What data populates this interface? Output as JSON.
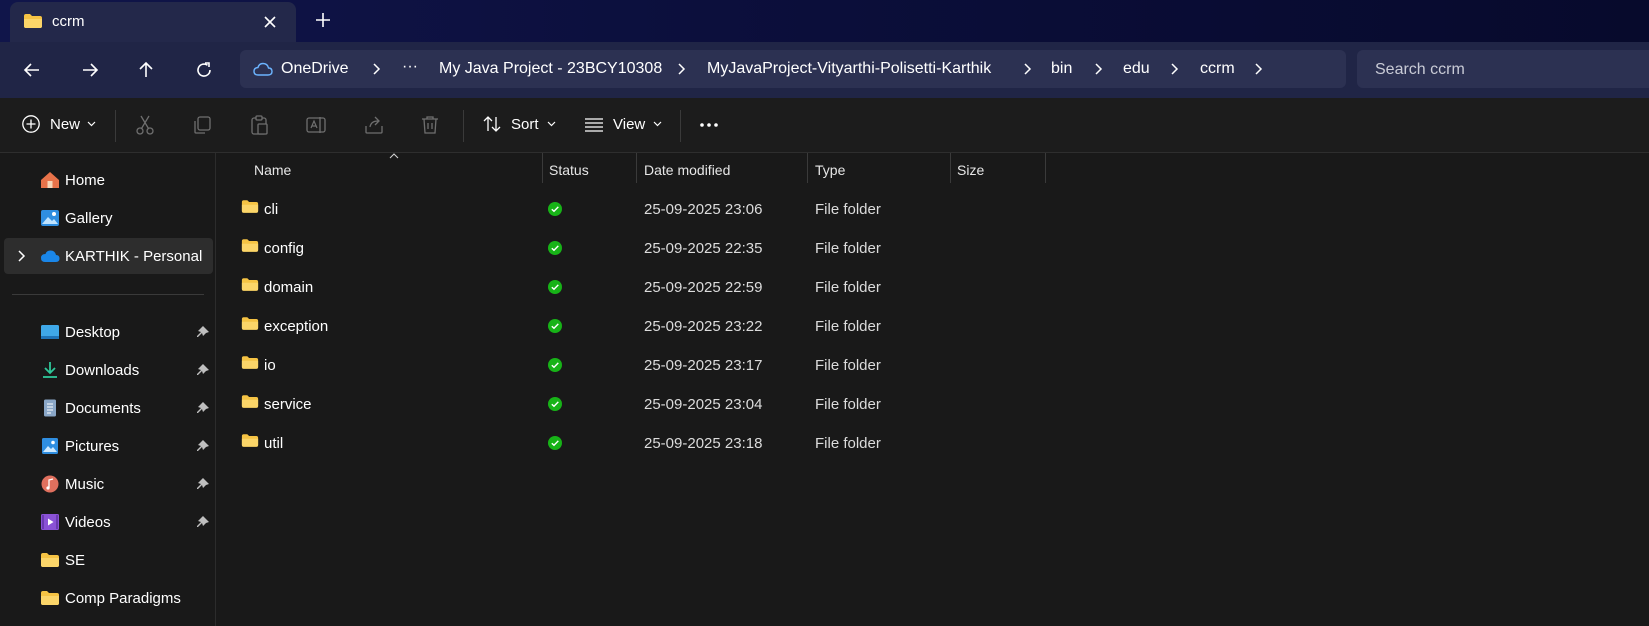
{
  "tab": {
    "title": "ccrm"
  },
  "address": {
    "root": "OneDrive",
    "overflow": "···",
    "crumbs": [
      "My Java Project - 23BCY10308",
      "MyJavaProject-Vityarthi-Polisetti-Karthik",
      "bin",
      "edu",
      "ccrm"
    ]
  },
  "search": {
    "placeholder": "Search ccrm"
  },
  "toolbar": {
    "new_label": "New",
    "sort_label": "Sort",
    "view_label": "View"
  },
  "sidebar": {
    "top": [
      {
        "label": "Home",
        "icon": "home-icon"
      },
      {
        "label": "Gallery",
        "icon": "gallery-icon"
      },
      {
        "label": "KARTHIK - Personal",
        "icon": "onedrive-icon"
      }
    ],
    "quick": [
      {
        "label": "Desktop",
        "icon": "desktop-icon",
        "pinned": true
      },
      {
        "label": "Downloads",
        "icon": "downloads-icon",
        "pinned": true
      },
      {
        "label": "Documents",
        "icon": "documents-icon",
        "pinned": true
      },
      {
        "label": "Pictures",
        "icon": "pictures-icon",
        "pinned": true
      },
      {
        "label": "Music",
        "icon": "music-icon",
        "pinned": true
      },
      {
        "label": "Videos",
        "icon": "videos-icon",
        "pinned": true
      },
      {
        "label": "SE",
        "icon": "folder-icon",
        "pinned": false
      },
      {
        "label": "Comp Paradigms",
        "icon": "folder-icon",
        "pinned": false
      }
    ]
  },
  "columns": {
    "name": "Name",
    "status": "Status",
    "date": "Date modified",
    "type": "Type",
    "size": "Size"
  },
  "files": [
    {
      "name": "cli",
      "date": "25-09-2025 23:06",
      "type": "File folder"
    },
    {
      "name": "config",
      "date": "25-09-2025 22:35",
      "type": "File folder"
    },
    {
      "name": "domain",
      "date": "25-09-2025 22:59",
      "type": "File folder"
    },
    {
      "name": "exception",
      "date": "25-09-2025 23:22",
      "type": "File folder"
    },
    {
      "name": "io",
      "date": "25-09-2025 23:17",
      "type": "File folder"
    },
    {
      "name": "service",
      "date": "25-09-2025 23:04",
      "type": "File folder"
    },
    {
      "name": "util",
      "date": "25-09-2025 23:18",
      "type": "File folder"
    }
  ],
  "colors": {
    "status_synced": "#17b317",
    "folder": "#f5c344",
    "title_bar": "#10154a"
  }
}
